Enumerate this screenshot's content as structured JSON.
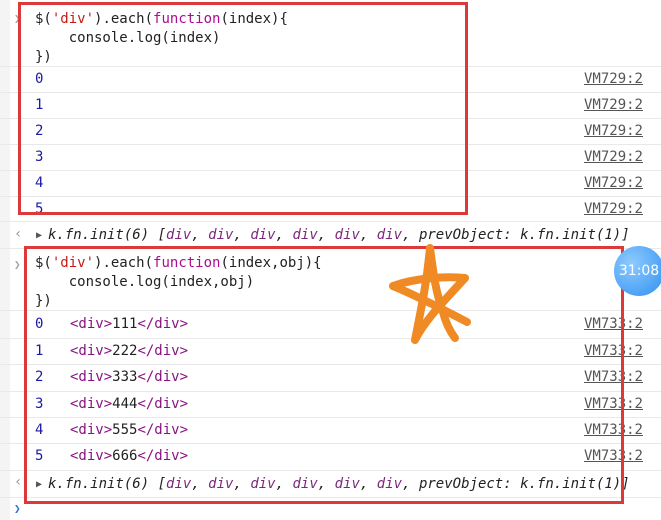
{
  "console": {
    "block1": {
      "code_line1": {
        "a": "$(",
        "b": "'div'",
        "c": ").each(",
        "d": "function",
        "e": "(index){"
      },
      "code_line2": "    console.log(index)",
      "code_line3": "})",
      "rows": [
        {
          "value": "0",
          "source": "VM729:2"
        },
        {
          "value": "1",
          "source": "VM729:2"
        },
        {
          "value": "2",
          "source": "VM729:2"
        },
        {
          "value": "3",
          "source": "VM729:2"
        },
        {
          "value": "4",
          "source": "VM729:2"
        },
        {
          "value": "5",
          "source": "VM729:2"
        }
      ],
      "return_value": "k.fn.init(6) [div, div, div, div, div, div, prevObject: k.fn.init(1)]"
    },
    "block2": {
      "code_line1": {
        "a": "$(",
        "b": "'div'",
        "c": ").each(",
        "d": "function",
        "e": "(index,obj){"
      },
      "code_line2": "    console.log(index,obj)",
      "code_line3": "})",
      "rows": [
        {
          "value": "0",
          "open": "<div>",
          "text": "111",
          "close": "</div>",
          "source": "VM733:2"
        },
        {
          "value": "1",
          "open": "<div>",
          "text": "222",
          "close": "</div>",
          "source": "VM733:2"
        },
        {
          "value": "2",
          "open": "<div>",
          "text": "333",
          "close": "</div>",
          "source": "VM733:2"
        },
        {
          "value": "3",
          "open": "<div>",
          "text": "444",
          "close": "</div>",
          "source": "VM733:2"
        },
        {
          "value": "4",
          "open": "<div>",
          "text": "555",
          "close": "</div>",
          "source": "VM733:2"
        },
        {
          "value": "5",
          "open": "<div>",
          "text": "666",
          "close": "</div>",
          "source": "VM733:2"
        }
      ],
      "return_value": "k.fn.init(6) [div, div, div, div, div, div, prevObject: k.fn.init(1)]"
    },
    "timer": "31:08",
    "colors": {
      "highlight_box": "#dc3a3a",
      "star": "#f08a24",
      "number": "#1a1aa6",
      "tag": "#881280"
    }
  }
}
